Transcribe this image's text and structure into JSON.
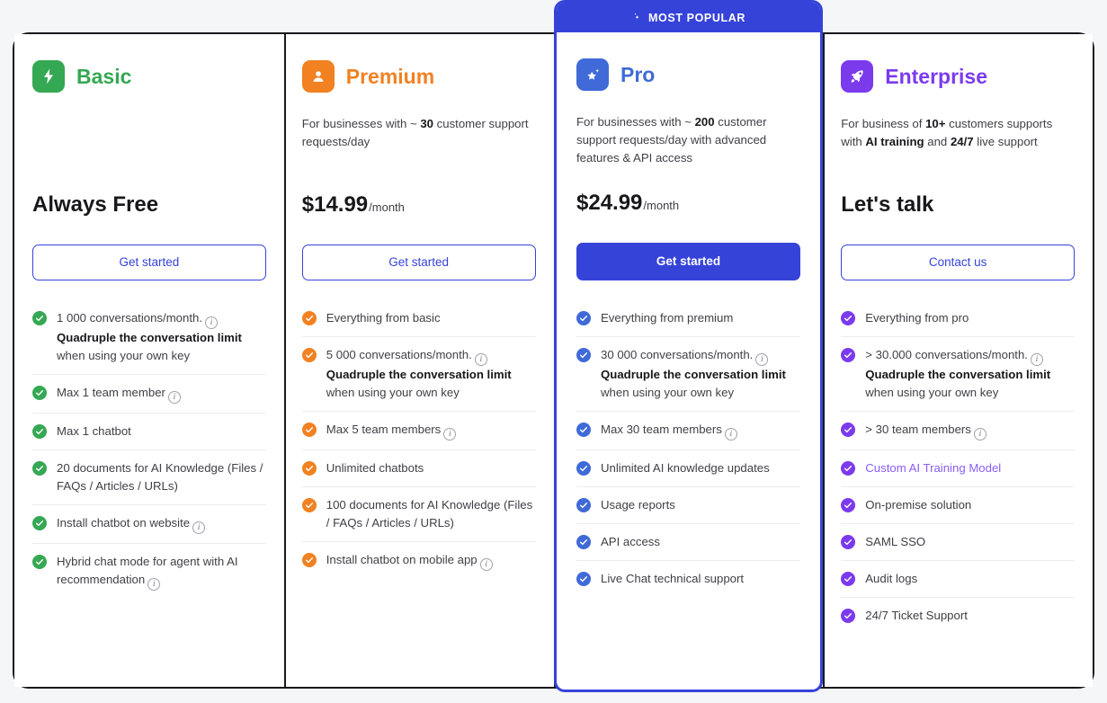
{
  "badge": {
    "label": "MOST POPULAR",
    "icon": "sparkle-icon",
    "color": "#3643d9"
  },
  "plans": [
    {
      "id": "basic",
      "name": "Basic",
      "color": "#35a853",
      "icon": "lightning-bolt-icon",
      "description": "",
      "price": "Always Free",
      "period": "",
      "cta": "Get started",
      "cta_style": "outline",
      "features": [
        {
          "text": "1 000 conversations/month.",
          "info": true,
          "bold_line": "Quadruple the conversation limit",
          "sub": "when using your own key"
        },
        {
          "text": "Max 1 team member",
          "info": true
        },
        {
          "text": "Max 1 chatbot",
          "info": false
        },
        {
          "text": "20 documents for AI Knowledge (Files / FAQs / Articles / URLs)",
          "info": false
        },
        {
          "text": "Install chatbot on website",
          "info": true
        },
        {
          "text": "Hybrid chat mode for agent with AI recommendation",
          "info": true
        }
      ]
    },
    {
      "id": "premium",
      "name": "Premium",
      "color": "#f18121",
      "icon": "user-badge-icon",
      "description_prefix": "For businesses with ~ ",
      "description_bold": "30",
      "description_suffix": " customer support requests/day",
      "price": "$14.99",
      "period": "/month",
      "cta": "Get started",
      "cta_style": "outline",
      "features": [
        {
          "text": "Everything from basic",
          "info": false
        },
        {
          "text": "5 000 conversations/month.",
          "info": true,
          "bold_line": "Quadruple the conversation limit",
          "sub": "when using your own key"
        },
        {
          "text": "Max 5 team members",
          "info": true
        },
        {
          "text": "Unlimited chatbots",
          "info": false
        },
        {
          "text": "100 documents for AI Knowledge (Files / FAQs / Articles / URLs)",
          "info": false
        },
        {
          "text": "Install chatbot on mobile app",
          "info": true
        }
      ]
    },
    {
      "id": "pro",
      "name": "Pro",
      "color": "#3f6ad8",
      "icon": "star-sparkle-icon",
      "description_prefix": "For businesses with ~ ",
      "description_bold": "200",
      "description_suffix": " customer support requests/day with advanced features & API access",
      "price": "$24.99",
      "period": "/month",
      "cta": "Get started",
      "cta_style": "filled",
      "features": [
        {
          "text": "Everything from premium",
          "info": false
        },
        {
          "text": "30 000 conversations/month.",
          "info": true,
          "bold_line": "Quadruple the conversation limit",
          "sub": "when using your own key"
        },
        {
          "text": "Max 30 team members",
          "info": true
        },
        {
          "text": "Unlimited AI knowledge updates",
          "info": false
        },
        {
          "text": "Usage reports",
          "info": false
        },
        {
          "text": "API access",
          "info": false
        },
        {
          "text": "Live Chat technical support",
          "info": false
        }
      ]
    },
    {
      "id": "enterprise",
      "name": "Enterprise",
      "color": "#7c3aed",
      "icon": "rocket-icon",
      "description_prefix": "For business of ",
      "description_bold": "10+",
      "description_mid": " customers supports with ",
      "description_bold2": "AI training",
      "description_mid2": " and ",
      "description_bold3": "24/7",
      "description_suffix": " live support",
      "price": "Let's talk",
      "period": "",
      "cta": "Contact us",
      "cta_style": "outline",
      "features": [
        {
          "text": "Everything from pro",
          "info": false
        },
        {
          "text": "> 30.000 conversations/month.",
          "info": true,
          "bold_line": "Quadruple the conversation limit",
          "sub": "when using your own key"
        },
        {
          "text": "> 30 team members",
          "info": true
        },
        {
          "text": "Custom AI Training Model",
          "info": false,
          "accent": true
        },
        {
          "text": "On-premise solution",
          "info": false
        },
        {
          "text": "SAML SSO",
          "info": false
        },
        {
          "text": "Audit logs",
          "info": false
        },
        {
          "text": "24/7 Ticket Support",
          "info": false
        }
      ]
    }
  ]
}
